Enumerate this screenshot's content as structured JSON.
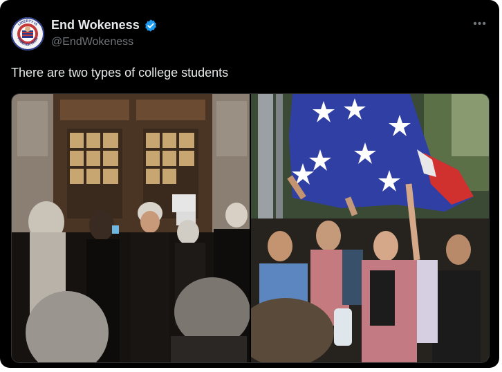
{
  "tweet": {
    "display_name": "End Wokeness",
    "handle": "@EndWokeness",
    "text": "There are two types of college students",
    "more_icon": "more-horizontal-icon",
    "verified_icon": "verified-badge-icon",
    "avatar_text_top": "LIBERTY IS",
    "avatar_text_bottom": "FOREVER FREE"
  },
  "colors": {
    "background": "#000000",
    "primary_text": "#e7e9ea",
    "secondary_text": "#71767b",
    "verified_blue": "#1d9bf0"
  }
}
